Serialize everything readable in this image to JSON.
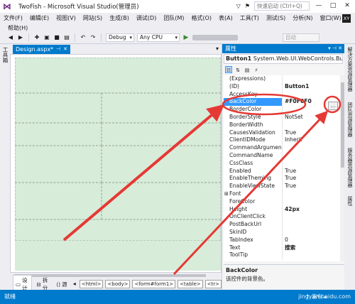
{
  "window": {
    "title": "TwoFish - Microsoft Visual Studio(管理员)",
    "quick_launch_placeholder": "快速启动 (Ctrl+Q)",
    "minimize": "—",
    "maximize": "□",
    "close": "✕",
    "user_initials": "XY"
  },
  "menu": {
    "items": [
      "文件(F)",
      "编辑(E)",
      "视图(V)",
      "网站(S)",
      "生成(B)",
      "调试(D)",
      "团队(M)",
      "格式(O)",
      "表(A)",
      "工具(T)",
      "测试(S)",
      "分析(N)",
      "窗口(W)"
    ],
    "help": "帮助(H)"
  },
  "toolbar": {
    "config": "Debug",
    "platform": "Any CPU",
    "auto": "自动"
  },
  "sidebar": {
    "left_label": "工具箱",
    "right_labels": [
      "解决方案资源管理器",
      "团队资源管理器",
      "服务器资源管理器",
      "属性"
    ]
  },
  "document": {
    "tab_label": "Design.aspx*",
    "view_tabs": [
      "设计",
      "拆分",
      "源"
    ],
    "breadcrumbs": [
      "<html>",
      "<body>",
      "<form#form1>",
      "<table>",
      "<tr>"
    ]
  },
  "properties": {
    "header": "属性",
    "object_name": "Button1",
    "object_type": "System.Web.UI.WebControls.Button",
    "rows": [
      {
        "name": "(Expressions)",
        "value": ""
      },
      {
        "name": "(ID)",
        "value": "Button1",
        "bold": true
      },
      {
        "name": "AccessKey",
        "value": ""
      },
      {
        "name": "BackColor",
        "value": "#F0F0F0",
        "selected": true
      },
      {
        "name": "BorderColor",
        "value": ""
      },
      {
        "name": "BorderStyle",
        "value": "NotSet"
      },
      {
        "name": "BorderWidth",
        "value": ""
      },
      {
        "name": "CausesValidation",
        "value": "True"
      },
      {
        "name": "ClientIDMode",
        "value": "Inherit"
      },
      {
        "name": "CommandArgument",
        "value": ""
      },
      {
        "name": "CommandName",
        "value": ""
      },
      {
        "name": "CssClass",
        "value": ""
      },
      {
        "name": "Enabled",
        "value": "True"
      },
      {
        "name": "EnableTheming",
        "value": "True"
      },
      {
        "name": "EnableViewState",
        "value": "True"
      },
      {
        "name": "Font",
        "value": "",
        "expandable": true
      },
      {
        "name": "ForeColor",
        "value": ""
      },
      {
        "name": "Height",
        "value": "42px",
        "bold": true
      },
      {
        "name": "OnClientClick",
        "value": ""
      },
      {
        "name": "PostBackUrl",
        "value": ""
      },
      {
        "name": "SkinID",
        "value": ""
      },
      {
        "name": "TabIndex",
        "value": "0"
      },
      {
        "name": "Text",
        "value": "搜索",
        "bold": true
      },
      {
        "name": "ToolTip",
        "value": ""
      }
    ],
    "ellipsis_label": "...",
    "description_title": "BackColor",
    "description_text": "该控件的背景色。"
  },
  "status": {
    "text": "就绪",
    "publish": "↑ 发布 ▴"
  },
  "watermark": "jingyan.baidu.com",
  "colors": {
    "accent": "#007acc",
    "annotation": "#e53935",
    "design_surface": "#d7ecd9"
  }
}
